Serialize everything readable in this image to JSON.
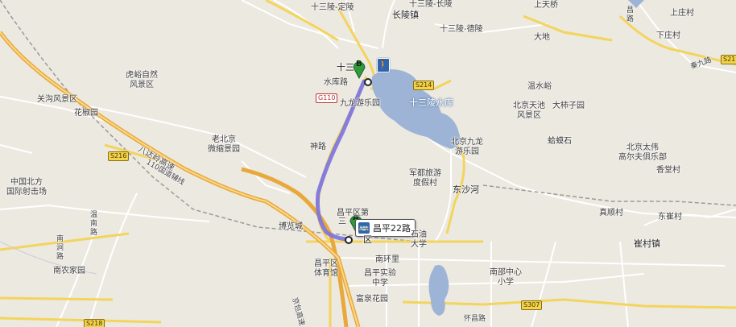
{
  "map": {
    "water_color": "#9db4d6",
    "route_color": "#7b72e0",
    "highway_color": "#f5c048",
    "markers": {
      "b_letter": "B",
      "a_letter": "A"
    },
    "route_callout": {
      "label": "昌平22路",
      "icon": "bus-icon"
    },
    "walk_icon": "pedestrian-icon",
    "places": {
      "shisanling_dingling": "十三陵-定陵",
      "changling_town": "长陵镇",
      "changling_top": "十三陵-长陵",
      "shisanling_deling": "十三陵-德陵",
      "shangtianqiao": "上天桥",
      "dadi": "大地",
      "wenshuiyu": "温水峪",
      "shangzhuangcun": "上庄村",
      "xiazhuangcun": "下庄村",
      "huyu": "虎峪自然\n风景区",
      "guangou": "关沟风景区",
      "huajiaoyuan": "花椒园",
      "shuikulu": "水库路",
      "shisan_short": "十三",
      "shisanling_reservoir": "十三陵水库",
      "jiulong_park": "九龙游乐园",
      "beijing_tianchi": "北京天池\n风景区",
      "dashizi_yuan": "大柿子园",
      "beijing_jiulong": "北京九龙\n游乐园",
      "hamashi": "蛤蟆石",
      "beijing_taiwei": "北京太伟\n高尔夫俱乐部",
      "xiangtangcun": "香堂村",
      "laobeijing": "老北京\n微缩景园",
      "shenlu": "神路",
      "junduly": "军都旅游\n度假村",
      "dongshahe": "东沙河",
      "zhongguo_beifang": "中国北方\n国际射击场",
      "changping_yuandi": "昌平区第",
      "san": "三",
      "changping_qu": "区",
      "bolancheng": "博览城",
      "shiyou_daxue": "石油\n大学",
      "nanhuanli": "南环里",
      "changping_tiyuguan": "昌平区\n体育馆",
      "changping_shiyan": "昌平实验\n中学",
      "fuquan_huayuan": "富泉花园",
      "nanshao_xiaoxue": "南邵中心\n小学",
      "zhenshuncun": "真顺村",
      "dongcuncun": "东崔村",
      "cuicun_town": "崔村镇",
      "nannonjiayuan": "南农家园",
      "wennan_lu": "温\n南\n路",
      "nanjiao_lu": "南\n涧\n路",
      "badaling": "八达岭高速",
      "fuxian_110": "110国道辅线",
      "jingbao": "京包高速",
      "huaichang_lu": "怀昌路",
      "changlu_right": "昌\n路",
      "qiaoqiu_lu": "秦九路"
    },
    "shields": {
      "g110": "G110",
      "s214": "S214",
      "s216": "S216",
      "s307": "S307",
      "s218": "S218",
      "s21x": "S21"
    }
  }
}
